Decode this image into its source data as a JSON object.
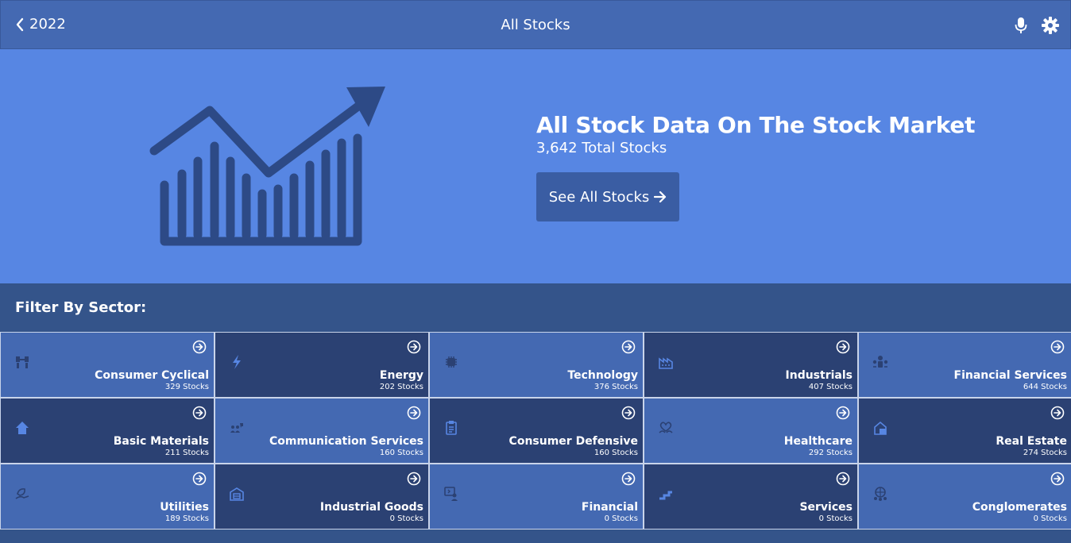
{
  "header": {
    "back_label": "2022",
    "title": "All Stocks",
    "icons": [
      "chevron-left-icon",
      "microphone-icon",
      "gear-icon"
    ]
  },
  "hero": {
    "heading": "All Stock Data On The Stock Market",
    "subheading": "3,642 Total Stocks",
    "button_label": "See All Stocks",
    "graphic": "rising-chart-icon"
  },
  "filter": {
    "title": "Filter By Sector:",
    "sectors": [
      {
        "name": "Consumer Cyclical",
        "count": "329 Stocks",
        "icon": "tool-icon",
        "icon_color": "#2b4173"
      },
      {
        "name": "Energy",
        "count": "202 Stocks",
        "icon": "lightning-icon",
        "icon_color": "#5786e3"
      },
      {
        "name": "Technology",
        "count": "376 Stocks",
        "icon": "chip-icon",
        "icon_color": "#2b4173"
      },
      {
        "name": "Industrials",
        "count": "407 Stocks",
        "icon": "factory-icon",
        "icon_color": "#5786e3"
      },
      {
        "name": "Financial Services",
        "count": "644 Stocks",
        "icon": "people-icon",
        "icon_color": "#2b4173"
      },
      {
        "name": "Basic Materials",
        "count": "211 Stocks",
        "icon": "home-icon",
        "icon_color": "#5786e3"
      },
      {
        "name": "Communication Services",
        "count": "160 Stocks",
        "icon": "users-chat-icon",
        "icon_color": "#2b4173"
      },
      {
        "name": "Consumer Defensive",
        "count": "160 Stocks",
        "icon": "clipboard-icon",
        "icon_color": "#5786e3"
      },
      {
        "name": "Healthcare",
        "count": "292 Stocks",
        "icon": "heart-hands-icon",
        "icon_color": "#2b4173"
      },
      {
        "name": "Real Estate",
        "count": "274 Stocks",
        "icon": "house-ledger-icon",
        "icon_color": "#5786e3"
      },
      {
        "name": "Utilities",
        "count": "189 Stocks",
        "icon": "hand-leaf-icon",
        "icon_color": "#2b4173"
      },
      {
        "name": "Industrial Goods",
        "count": "0 Stocks",
        "icon": "warehouse-icon",
        "icon_color": "#5786e3"
      },
      {
        "name": "Financial",
        "count": "0 Stocks",
        "icon": "presenter-icon",
        "icon_color": "#2b4173"
      },
      {
        "name": "Services",
        "count": "0 Stocks",
        "icon": "steps-icon",
        "icon_color": "#5786e3"
      },
      {
        "name": "Conglomerates",
        "count": "0 Stocks",
        "icon": "globe-people-icon",
        "icon_color": "#2b4173"
      }
    ]
  },
  "colors": {
    "header_bg": "#4469b2",
    "hero_bg": "#5786e3",
    "dark_tile": "#2b4173",
    "light_tile": "#4469b2",
    "filter_bg": "#34548a"
  }
}
